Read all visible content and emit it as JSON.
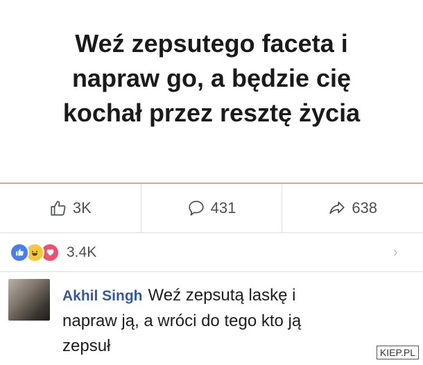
{
  "post": {
    "line1": "Weź zepsutego faceta i",
    "line2": "napraw go, a będzie cię",
    "line3": "kochał przez resztę życia"
  },
  "actions": {
    "likes": "3K",
    "comments": "431",
    "shares": "638"
  },
  "reactions": {
    "count": "3.4K",
    "icons": [
      "like-icon",
      "haha-icon",
      "love-icon"
    ]
  },
  "comment": {
    "author": "Akhil Singh",
    "text": "Weź zepsutą laskę i napraw ją, a wróci do tego kto ją zepsuł"
  },
  "watermark": "KIEP.PL",
  "colors": {
    "like": "#4a7cf6",
    "haha": "#f7c737",
    "love": "#f0506e",
    "author": "#365899"
  }
}
